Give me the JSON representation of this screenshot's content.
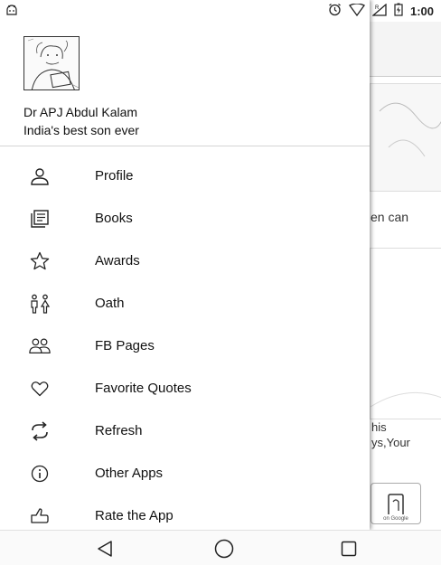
{
  "status_bar": {
    "time": "1:00",
    "icons": [
      "android-icon",
      "alarm-icon",
      "wifi-icon",
      "signal-icon",
      "battery-icon"
    ]
  },
  "drawer": {
    "header": {
      "name": "Dr APJ Abdul Kalam",
      "tagline": "India's best son ever"
    },
    "items": [
      {
        "label": "Profile",
        "icon": "person-icon"
      },
      {
        "label": "Books",
        "icon": "books-icon"
      },
      {
        "label": "Awards",
        "icon": "star-icon"
      },
      {
        "label": "Oath",
        "icon": "people-pair-icon"
      },
      {
        "label": "FB Pages",
        "icon": "group-icon"
      },
      {
        "label": "Favorite Quotes",
        "icon": "heart-icon"
      },
      {
        "label": "Refresh",
        "icon": "refresh-icon"
      },
      {
        "label": "Other Apps",
        "icon": "info-icon"
      },
      {
        "label": "Rate the App",
        "icon": "thumbs-up-icon"
      }
    ]
  },
  "background": {
    "text_fragment_1": "en can",
    "text_fragment_2_line1": "his",
    "text_fragment_2_line2": "ys,Your",
    "badge_text": "on Google"
  },
  "nav_bar": {
    "icons": [
      "back-icon",
      "home-icon",
      "recents-icon"
    ]
  }
}
